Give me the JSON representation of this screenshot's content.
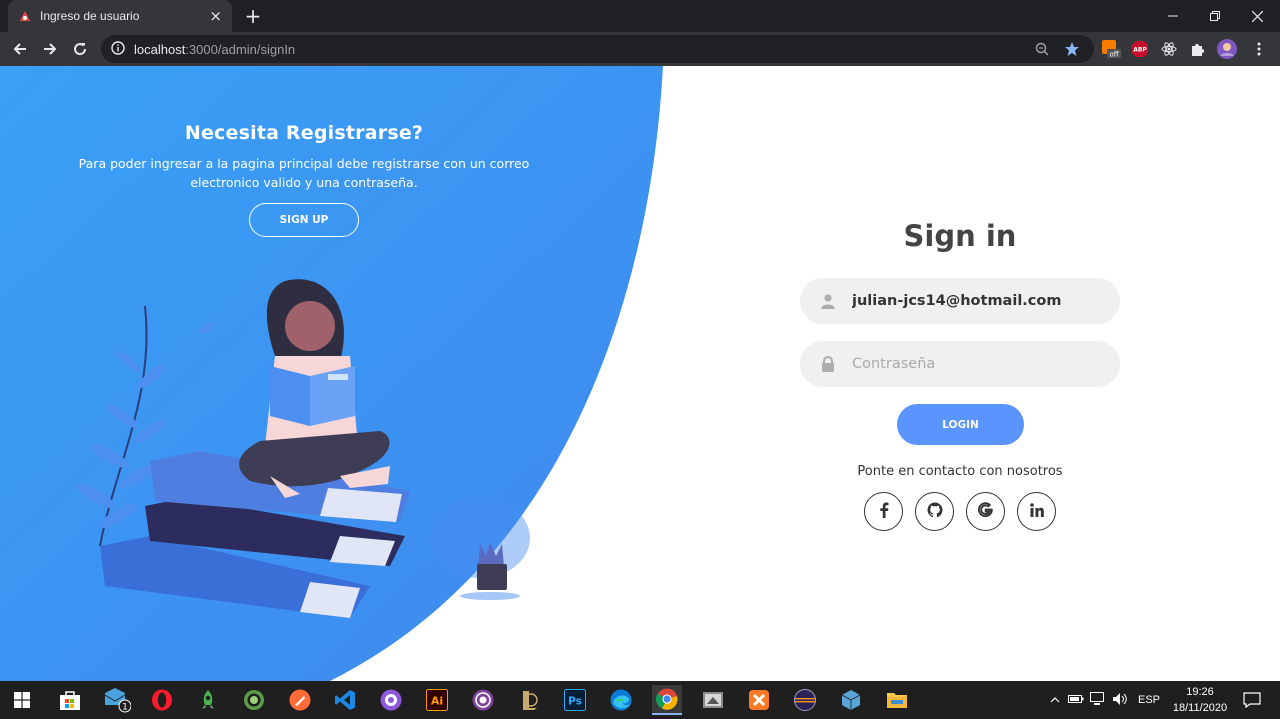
{
  "browser": {
    "tab_title": "Ingreso de usuario",
    "close_glyph": "×",
    "new_tab_glyph": "+",
    "url_host": "localhost",
    "url_rest": ":3000/admin/signIn",
    "extension_labels": {
      "off": "off",
      "abp": "ABP"
    }
  },
  "promo": {
    "title": "Necesita Registrarse?",
    "text": "Para poder ingresar a la pagina principal debe registrarse con un correo electronico valido y una contraseña.",
    "signup_label": "SIGN UP"
  },
  "signin": {
    "title": "Sign in",
    "email_value": "julian-jcs14@hotmail.com",
    "password_placeholder": "Contraseña",
    "login_label": "LOGIN",
    "contact_text": "Ponte en contacto con nosotros",
    "social": [
      "facebook",
      "github",
      "google",
      "linkedin"
    ]
  },
  "taskbar": {
    "mail_badge": "1",
    "language": "ESP",
    "time": "19:26",
    "date": "18/11/2020",
    "ai_label": "Ai",
    "ps_label": "Ps"
  },
  "colors": {
    "primary_blue": "#4481eb",
    "light_blue": "#04befe",
    "login_button": "#5995fd",
    "input_bg": "#f0f0f0"
  }
}
